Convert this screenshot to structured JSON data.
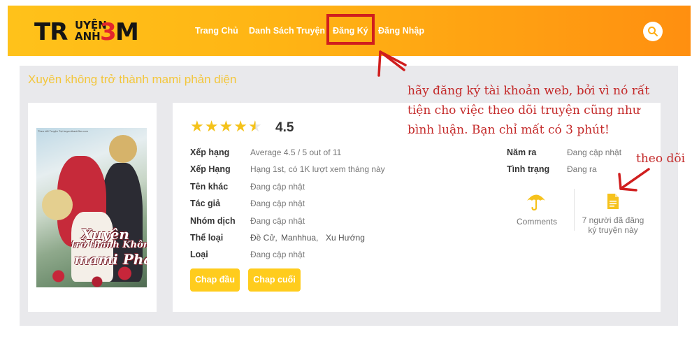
{
  "header": {
    "logo": {
      "part1": "TR",
      "part2a": "UYỆN",
      "part2b": "ANH",
      "part3": "3",
      "part4": "M"
    },
    "nav": [
      "Trang Chủ",
      "Danh Sách Truyện",
      "Đăng Ký",
      "Đăng Nhập"
    ],
    "search_icon": "search-icon",
    "highlight_color": "#d01e1e"
  },
  "story": {
    "title": "Xuyên không trở thành mami phản diện",
    "cover": {
      "credit": "Theo dõi Truyện Tại truyenthanh3m.com",
      "title_line1": "Xuyên",
      "title_line2": "trở thành Không",
      "title_line3": "mami Phản diện"
    },
    "rating": {
      "stars_text": "★★★★★",
      "value": "4.5",
      "stars": 4.5
    },
    "details": [
      {
        "label": "Xếp hạng",
        "value": "Average 4.5 / 5 out of 11"
      },
      {
        "label": "Xếp Hạng",
        "value": "Hạng 1st, có 1K lượt xem tháng này"
      },
      {
        "label": "Tên khác",
        "value": "Đang cập nhật"
      },
      {
        "label": "Tác giả",
        "value": "Đang cập nhật"
      },
      {
        "label": "Nhóm dịch",
        "value": "Đang cập nhật"
      },
      {
        "label": "Thể loại",
        "genres": [
          "Đề Cử,",
          "Manhhua,",
          "Xu Hướng"
        ]
      },
      {
        "label": "Loại",
        "value": "Đang cập nhật"
      }
    ],
    "side_details": [
      {
        "label": "Năm ra",
        "value": "Đang cập nhật"
      },
      {
        "label": "Tình trạng",
        "value": "Đang ra"
      }
    ],
    "buttons": {
      "first": "Chap đầu",
      "last": "Chap cuối"
    },
    "stats": {
      "comments_label": "Comments",
      "follow_label": "7 người đã đăng ký truyện này"
    }
  },
  "annotations": {
    "main": "hãy đăng ký tài khoản web, bởi vì nó rất tiện cho việc theo dõi truyện cũng như bình luận. Bạn chỉ mất có 3 phút!",
    "follow": "theo dõi",
    "color": "#c42a2a"
  },
  "colors": {
    "accent": "#ffcc1d",
    "title": "#f3c63b",
    "star": "#f4c21a"
  }
}
